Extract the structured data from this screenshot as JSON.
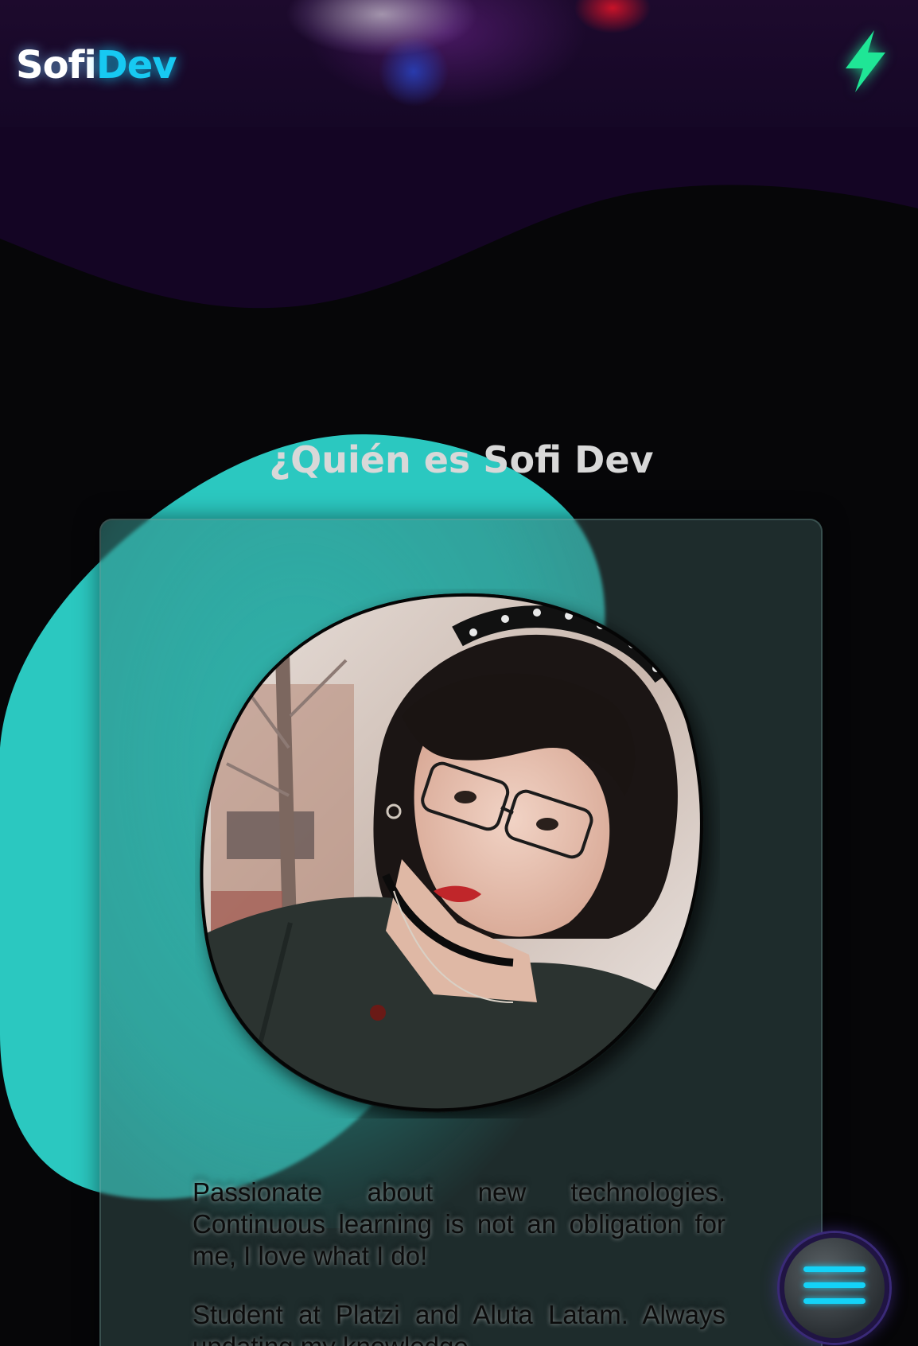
{
  "header": {
    "logo_part1": "Sofi",
    "logo_part2": "Dev",
    "action_icon": "lightning-bolt-icon"
  },
  "about": {
    "title": "¿Quién es Sofi Dev",
    "photo_alt": "Sofi Dev profile photo",
    "bio_paragraph_1": "Passionate about new technologies. Continuous learning is not an obligation for me, I love what I do!",
    "bio_paragraph_2": "Student at Platzi and Aluta Latam. Always updating my knowledge."
  },
  "menu": {
    "icon": "hamburger-menu-icon"
  },
  "colors": {
    "accent_cyan": "#17c9f2",
    "bolt_green": "#1fe696",
    "blob_teal": "#2bc8c0",
    "wave_purple": "#150726",
    "background": "#060608"
  }
}
